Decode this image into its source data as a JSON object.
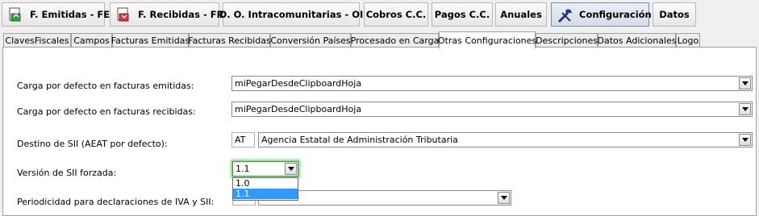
{
  "toolbar": {
    "buttons": [
      {
        "label": "F. Emitidas - FE",
        "icon": "green-document-icon"
      },
      {
        "label": "F. Recibidas - FR",
        "icon": "red-document-icon"
      },
      {
        "label": "D. O. Intracomunitarias - OI"
      },
      {
        "label": "Cobros C.C."
      },
      {
        "label": "Pagos C.C."
      },
      {
        "label": "Anuales"
      },
      {
        "label": "Configuración",
        "icon": "wrench-screwdriver-icon",
        "active": true
      },
      {
        "label": "Datos"
      }
    ]
  },
  "tabs": [
    {
      "label": "ClavesFiscales"
    },
    {
      "label": "Campos"
    },
    {
      "label": "Facturas Emitidas"
    },
    {
      "label": "Facturas Recibidas"
    },
    {
      "label": "Conversión Países"
    },
    {
      "label": "Procesado en Carga"
    },
    {
      "label": "Otras Configuraciones",
      "active": true
    },
    {
      "label": "Descripciones"
    },
    {
      "label": "Datos Adicionales"
    },
    {
      "label": "Logo"
    }
  ],
  "form": {
    "carga_emitidas": {
      "label": "Carga por defecto en facturas emitidas:",
      "value": "miPegarDesdeClipboardHoja"
    },
    "carga_recibidas": {
      "label": "Carga por defecto en facturas recibidas:",
      "value": "miPegarDesdeClipboardHoja"
    },
    "destino_sii": {
      "label": "Destino de SII (AEAT por defecto):",
      "code": "AT",
      "value": "Agencia Estatal de Administración Tributaria"
    },
    "version_sii": {
      "label": "Versión de SII forzada:",
      "value": "1.1",
      "options": [
        "1.0",
        "1.1"
      ],
      "selected": "1.1"
    },
    "periodicidad": {
      "label": "Periodicidad para declaraciones de IVA y SII:",
      "value": ""
    }
  },
  "colors": {
    "highlight": "#3399ff",
    "focus_glow": "#7fd27f"
  }
}
